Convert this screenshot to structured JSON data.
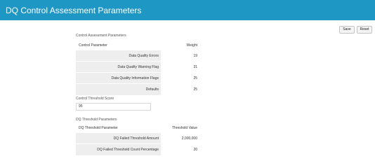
{
  "header": {
    "title": "DQ Control Assessment Parameters"
  },
  "toolbar": {
    "save_label": "Save",
    "reset_label": "Reset"
  },
  "control_assessment": {
    "section_label": "Control Assessment Parameters",
    "col_param": "Control Parameter",
    "col_weight": "Weight",
    "rows": [
      {
        "param": "Data Quality Errors",
        "weight": "19"
      },
      {
        "param": "Data Quality Warning Flag",
        "weight": "31"
      },
      {
        "param": "Data Quality Information Flags",
        "weight": "25"
      },
      {
        "param": "Defaults",
        "weight": "25"
      }
    ]
  },
  "control_threshold": {
    "section_label": "Control Threshold Score",
    "value": "95"
  },
  "dq_threshold": {
    "section_label": "DQ Threshold Parameters",
    "col_param": "DQ Threshold Parameter",
    "col_value": "Threshold Value",
    "rows": [
      {
        "param": "DQ Failed Threshold Amount",
        "value": "2,000,000"
      },
      {
        "param": "DQ Failed Threshold Count Percentage",
        "value": "20"
      }
    ]
  }
}
